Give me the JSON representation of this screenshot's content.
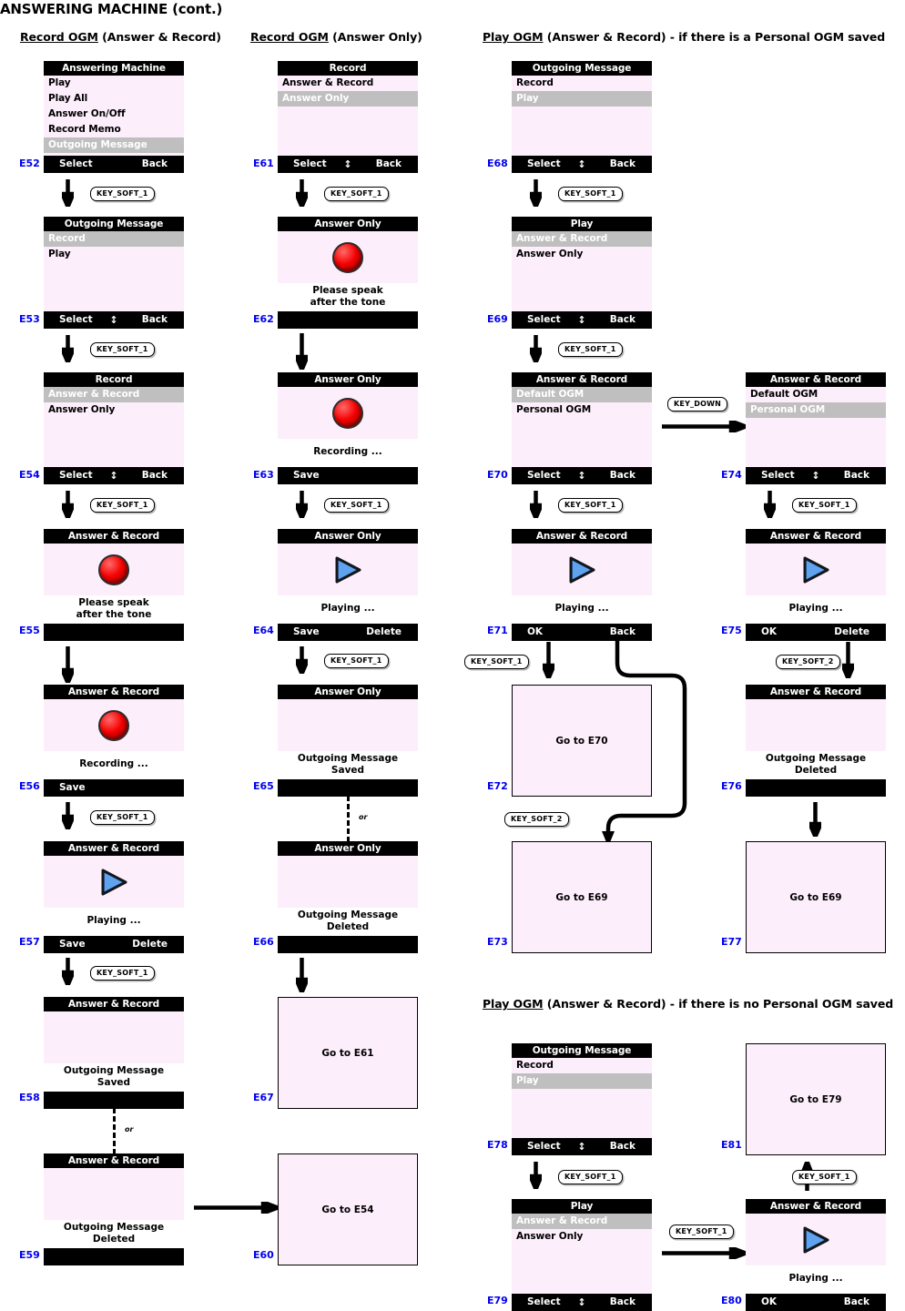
{
  "doc": {
    "title": "ANSWERING MACHINE (cont.)"
  },
  "sections": [
    {
      "id": "sec-record-ogm-ar",
      "underlined": "Record OGM",
      "rest": " (Answer & Record)"
    },
    {
      "id": "sec-record-ogm-ao",
      "underlined": "Record OGM",
      "rest": " (Answer Only)"
    },
    {
      "id": "sec-play-ogm-personal",
      "underlined": "Play OGM",
      "rest": " (Answer & Record) - if there is a Personal OGM saved"
    },
    {
      "id": "sec-play-ogm-no-personal",
      "underlined": "Play OGM",
      "rest": " (Answer & Record) - if there is no Personal OGM saved"
    }
  ],
  "labels": {
    "or": "or",
    "key_soft_1": "KEY_SOFT_1",
    "key_soft_2": "KEY_SOFT_2",
    "key_down": "KEY_DOWN",
    "updown_glyph": "↕"
  },
  "colors": {
    "screen_bg": "#fdeefb",
    "title_bar": "#000000",
    "highlight": "#bfbfbf",
    "highlight_text": "#ffffff",
    "enum_color": "#0000ee",
    "record_red": "#f50000",
    "play_blue": "#4a90e2"
  },
  "screens": {
    "E52": {
      "id": "E52",
      "title": "Answering Machine",
      "items": [
        {
          "label": "Play",
          "selected": false
        },
        {
          "label": "Play All",
          "selected": false
        },
        {
          "label": "Answer On/Off",
          "selected": false
        },
        {
          "label": "Record Memo",
          "selected": false
        },
        {
          "label": "Outgoing Message",
          "selected": true
        }
      ],
      "soft_left": "Select",
      "soft_center": "",
      "soft_right": "Back"
    },
    "E53": {
      "id": "E53",
      "title": "Outgoing Message",
      "items": [
        {
          "label": "Record",
          "selected": true
        },
        {
          "label": "Play",
          "selected": false
        }
      ],
      "soft_left": "Select",
      "soft_center": "↕",
      "soft_right": "Back"
    },
    "E54": {
      "id": "E54",
      "title": "Record",
      "items": [
        {
          "label": "Answer & Record",
          "selected": true
        },
        {
          "label": "Answer Only",
          "selected": false
        }
      ],
      "soft_left": "Select",
      "soft_center": "↕",
      "soft_right": "Back"
    },
    "E55": {
      "id": "E55",
      "title": "Answer & Record",
      "icon": "record-dot-icon",
      "message": "Please speak\nafter the tone",
      "soft_left": "",
      "soft_center": "",
      "soft_right": ""
    },
    "E56": {
      "id": "E56",
      "title": "Answer & Record",
      "icon": "record-dot-icon",
      "message": "Recording ...",
      "soft_left": "Save",
      "soft_center": "",
      "soft_right": ""
    },
    "E57": {
      "id": "E57",
      "title": "Answer & Record",
      "icon": "play-triangle-icon",
      "message": "Playing ...",
      "soft_left": "Save",
      "soft_center": "",
      "soft_right": "Delete"
    },
    "E58": {
      "id": "E58",
      "title": "Answer & Record",
      "icon": "",
      "message": "Outgoing Message\nSaved",
      "soft_left": "",
      "soft_center": "",
      "soft_right": ""
    },
    "E59": {
      "id": "E59",
      "title": "Answer & Record",
      "icon": "",
      "message": "Outgoing Message\nDeleted",
      "soft_left": "",
      "soft_center": "",
      "soft_right": ""
    },
    "E60": {
      "id": "E60",
      "goto": "Go to E54"
    },
    "E61": {
      "id": "E61",
      "title": "Record",
      "items": [
        {
          "label": "Answer & Record",
          "selected": false
        },
        {
          "label": "Answer Only",
          "selected": true
        }
      ],
      "soft_left": "Select",
      "soft_center": "↕",
      "soft_right": "Back"
    },
    "E62": {
      "id": "E62",
      "title": "Answer Only",
      "icon": "record-dot-icon",
      "message": "Please speak\nafter the tone",
      "soft_left": "",
      "soft_center": "",
      "soft_right": ""
    },
    "E63": {
      "id": "E63",
      "title": "Answer Only",
      "icon": "record-dot-icon",
      "message": "Recording ...",
      "soft_left": "Save",
      "soft_center": "",
      "soft_right": ""
    },
    "E64": {
      "id": "E64",
      "title": "Answer Only",
      "icon": "play-triangle-icon",
      "message": "Playing ...",
      "soft_left": "Save",
      "soft_center": "",
      "soft_right": "Delete"
    },
    "E65": {
      "id": "E65",
      "title": "Answer Only",
      "icon": "",
      "message": "Outgoing Message\nSaved",
      "soft_left": "",
      "soft_center": "",
      "soft_right": ""
    },
    "E66": {
      "id": "E66",
      "title": "Answer Only",
      "icon": "",
      "message": "Outgoing Message\nDeleted",
      "soft_left": "",
      "soft_center": "",
      "soft_right": ""
    },
    "E67": {
      "id": "E67",
      "goto": "Go to E61"
    },
    "E68": {
      "id": "E68",
      "title": "Outgoing Message",
      "items": [
        {
          "label": "Record",
          "selected": false
        },
        {
          "label": "Play",
          "selected": true
        }
      ],
      "soft_left": "Select",
      "soft_center": "↕",
      "soft_right": "Back"
    },
    "E69": {
      "id": "E69",
      "title": "Play",
      "items": [
        {
          "label": "Answer & Record",
          "selected": true
        },
        {
          "label": "Answer Only",
          "selected": false
        }
      ],
      "soft_left": "Select",
      "soft_center": "↕",
      "soft_right": "Back"
    },
    "E70": {
      "id": "E70",
      "title": "Answer & Record",
      "items": [
        {
          "label": "Default OGM",
          "selected": true
        },
        {
          "label": "Personal OGM",
          "selected": false
        }
      ],
      "soft_left": "Select",
      "soft_center": "↕",
      "soft_right": "Back"
    },
    "E71": {
      "id": "E71",
      "title": "Answer & Record",
      "icon": "play-triangle-icon",
      "message": "Playing ...",
      "soft_left": "OK",
      "soft_center": "",
      "soft_right": "Back"
    },
    "E72": {
      "id": "E72",
      "goto": "Go to E70"
    },
    "E73": {
      "id": "E73",
      "goto": "Go to E69"
    },
    "E74": {
      "id": "E74",
      "title": "Answer & Record",
      "items": [
        {
          "label": "Default OGM",
          "selected": false
        },
        {
          "label": "Personal OGM",
          "selected": true
        }
      ],
      "soft_left": "Select",
      "soft_center": "↕",
      "soft_right": "Back"
    },
    "E75": {
      "id": "E75",
      "title": "Answer & Record",
      "icon": "play-triangle-icon",
      "message": "Playing ...",
      "soft_left": "OK",
      "soft_center": "",
      "soft_right": "Delete"
    },
    "E76": {
      "id": "E76",
      "title": "Answer & Record",
      "icon": "",
      "message": "Outgoing Message\nDeleted",
      "soft_left": "",
      "soft_center": "",
      "soft_right": ""
    },
    "E77": {
      "id": "E77",
      "goto": "Go to E69"
    },
    "E78": {
      "id": "E78",
      "title": "Outgoing Message",
      "items": [
        {
          "label": "Record",
          "selected": false
        },
        {
          "label": "Play",
          "selected": true
        }
      ],
      "soft_left": "Select",
      "soft_center": "↕",
      "soft_right": "Back"
    },
    "E79": {
      "id": "E79",
      "title": "Play",
      "items": [
        {
          "label": "Answer & Record",
          "selected": true
        },
        {
          "label": "Answer Only",
          "selected": false
        }
      ],
      "soft_left": "Select",
      "soft_center": "↕",
      "soft_right": "Back"
    },
    "E80": {
      "id": "E80",
      "title": "Answer & Record",
      "icon": "play-triangle-icon",
      "message": "Playing ...",
      "soft_left": "OK",
      "soft_center": "",
      "soft_right": "Back"
    },
    "E81": {
      "id": "E81",
      "goto": "Go to E79"
    }
  }
}
